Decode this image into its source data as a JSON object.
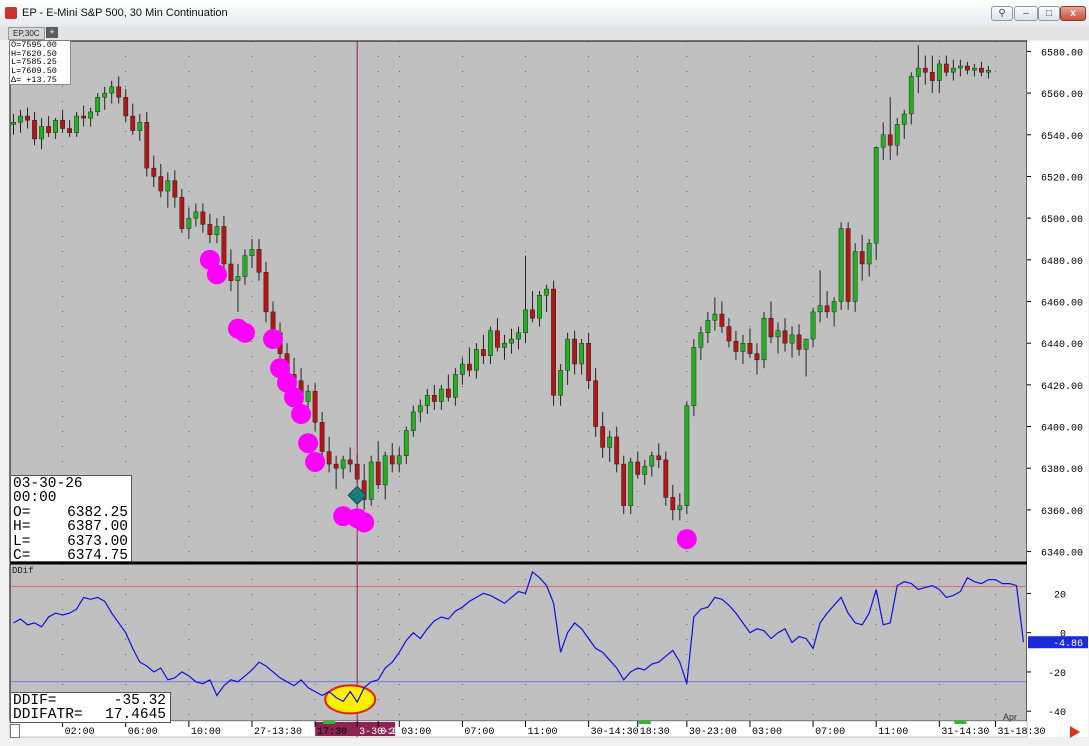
{
  "window": {
    "title": "EP - E-Mini S&P 500, 30 Min Continuation",
    "tab_label": "EP,30C",
    "add_tab": "+",
    "minimize": "–",
    "maximize": "□",
    "close": "x"
  },
  "ohlc_header": {
    "o": "O=7595.00",
    "h": "H=7620.50",
    "l": "L=7585.25",
    "l2": "L=7609.50",
    "d": "Δ= +13.75"
  },
  "data_window": {
    "date": "03-30-26",
    "time": "00:00",
    "o_label": "O=",
    "o": "6382.25",
    "h_label": "H=",
    "h": "6387.00",
    "l_label": "L=",
    "l": "6373.00",
    "c_label": "C=",
    "c": "6374.75"
  },
  "indicator": {
    "name": "DDif",
    "ddif_label": "DDIF=",
    "ddif": "-35.32",
    "ddifatr_label": "DDIFATR=",
    "ddifatr": "17.4645",
    "last_value": "-4.86"
  },
  "end_label": "Apr",
  "colors": {
    "up": "#22b022",
    "down": "#b01818",
    "wick": "#222222",
    "dot": "#ff00ff",
    "diamond": "#1a7a7a",
    "ddif_line": "#1010e0",
    "upper_ref": "#e06060",
    "lower_ref": "#6060e0",
    "cursor": "#8b2252",
    "ellipse_fill": "#ffee00",
    "ellipse_stroke": "#e02020",
    "plot_bg": "#c0c0c0"
  },
  "chart_data": [
    {
      "type": "candlestick",
      "ylim": [
        6335,
        6585
      ],
      "yticks": [
        6340,
        6360,
        6380,
        6400,
        6420,
        6440,
        6460,
        6480,
        6500,
        6520,
        6540,
        6560,
        6580
      ],
      "ytick_labels": [
        "6340.00",
        "6360.00",
        "6380.00",
        "6400.00",
        "6420.00",
        "6440.00",
        "6460.00",
        "6480.00",
        "6500.00",
        "6520.00",
        "6540.00",
        "6560.00",
        "6580.00"
      ],
      "xtick_labels": [
        "02:00",
        "06:00",
        "10:00",
        "27-13:30",
        "17:30",
        "3-30-26",
        "0:00",
        "03:00",
        "07:00",
        "11:00",
        "30-14:30",
        "18:30",
        "30-23:00",
        "03:00",
        "07:00",
        "11:00",
        "31-14:30",
        "31-18:30"
      ],
      "xtick_bars": [
        7,
        16,
        25,
        34,
        43,
        49,
        52,
        55,
        64,
        73,
        82,
        89,
        96,
        105,
        114,
        123,
        132,
        140
      ],
      "bar_count": 145,
      "candles": [
        [
          6545,
          6550,
          6540,
          6546
        ],
        [
          6546,
          6552,
          6541,
          6549
        ],
        [
          6549,
          6553,
          6543,
          6547
        ],
        [
          6547,
          6551,
          6535,
          6538
        ],
        [
          6538,
          6548,
          6533,
          6544
        ],
        [
          6544,
          6549,
          6539,
          6541
        ],
        [
          6541,
          6548,
          6538,
          6547
        ],
        [
          6547,
          6552,
          6541,
          6543
        ],
        [
          6543,
          6547,
          6539,
          6541
        ],
        [
          6541,
          6551,
          6539,
          6549
        ],
        [
          6549,
          6554,
          6544,
          6548
        ],
        [
          6548,
          6553,
          6544,
          6551
        ],
        [
          6551,
          6560,
          6549,
          6558
        ],
        [
          6558,
          6563,
          6552,
          6560
        ],
        [
          6560,
          6566,
          6555,
          6563
        ],
        [
          6563,
          6568,
          6555,
          6558
        ],
        [
          6558,
          6562,
          6546,
          6549
        ],
        [
          6549,
          6555,
          6540,
          6542
        ],
        [
          6542,
          6550,
          6537,
          6546
        ],
        [
          6546,
          6551,
          6520,
          6524
        ],
        [
          6524,
          6530,
          6515,
          6520
        ],
        [
          6520,
          6526,
          6510,
          6513
        ],
        [
          6513,
          6522,
          6505,
          6518
        ],
        [
          6518,
          6523,
          6505,
          6510
        ],
        [
          6510,
          6514,
          6493,
          6495
        ],
        [
          6495,
          6505,
          6490,
          6500
        ],
        [
          6500,
          6507,
          6496,
          6503
        ],
        [
          6503,
          6507,
          6493,
          6497
        ],
        [
          6497,
          6502,
          6488,
          6492
        ],
        [
          6492,
          6500,
          6488,
          6496
        ],
        [
          6496,
          6501,
          6475,
          6478
        ],
        [
          6478,
          6485,
          6465,
          6470
        ],
        [
          6470,
          6478,
          6455,
          6472
        ],
        [
          6472,
          6485,
          6468,
          6482
        ],
        [
          6482,
          6490,
          6476,
          6485
        ],
        [
          6485,
          6490,
          6470,
          6474
        ],
        [
          6474,
          6479,
          6450,
          6455
        ],
        [
          6455,
          6460,
          6440,
          6445
        ],
        [
          6445,
          6450,
          6430,
          6435
        ],
        [
          6435,
          6440,
          6420,
          6425
        ],
        [
          6425,
          6433,
          6418,
          6422
        ],
        [
          6422,
          6428,
          6408,
          6412
        ],
        [
          6412,
          6420,
          6405,
          6417
        ],
        [
          6417,
          6421,
          6398,
          6402
        ],
        [
          6402,
          6407,
          6385,
          6388
        ],
        [
          6388,
          6395,
          6378,
          6382
        ],
        [
          6382,
          6386,
          6370,
          6380
        ],
        [
          6380,
          6386,
          6375,
          6384
        ],
        [
          6384,
          6390,
          6378,
          6382
        ],
        [
          6382,
          6387,
          6373,
          6374.75
        ],
        [
          6374,
          6382,
          6360,
          6365
        ],
        [
          6365,
          6386,
          6362,
          6383
        ],
        [
          6383,
          6393,
          6370,
          6372
        ],
        [
          6372,
          6388,
          6365,
          6386
        ],
        [
          6386,
          6392,
          6378,
          6382
        ],
        [
          6382,
          6390,
          6378,
          6386
        ],
        [
          6386,
          6400,
          6382,
          6398
        ],
        [
          6398,
          6410,
          6395,
          6407
        ],
        [
          6407,
          6413,
          6402,
          6410
        ],
        [
          6410,
          6418,
          6406,
          6415
        ],
        [
          6415,
          6420,
          6408,
          6412
        ],
        [
          6412,
          6420,
          6408,
          6418
        ],
        [
          6418,
          6425,
          6412,
          6414
        ],
        [
          6414,
          6428,
          6410,
          6425
        ],
        [
          6425,
          6433,
          6420,
          6430
        ],
        [
          6430,
          6438,
          6424,
          6427
        ],
        [
          6427,
          6440,
          6423,
          6437
        ],
        [
          6437,
          6444,
          6430,
          6434
        ],
        [
          6434,
          6448,
          6430,
          6446
        ],
        [
          6446,
          6452,
          6436,
          6438
        ],
        [
          6438,
          6444,
          6432,
          6440
        ],
        [
          6440,
          6447,
          6435,
          6442
        ],
        [
          6442,
          6448,
          6437,
          6445
        ],
        [
          6445,
          6482,
          6440,
          6456
        ],
        [
          6456,
          6465,
          6450,
          6452
        ],
        [
          6452,
          6465,
          6448,
          6463
        ],
        [
          6463,
          6468,
          6455,
          6466
        ],
        [
          6466,
          6470,
          6410,
          6415
        ],
        [
          6415,
          6430,
          6410,
          6427
        ],
        [
          6427,
          6445,
          6420,
          6442
        ],
        [
          6442,
          6446,
          6425,
          6430
        ],
        [
          6430,
          6442,
          6425,
          6440
        ],
        [
          6440,
          6445,
          6418,
          6422
        ],
        [
          6422,
          6428,
          6395,
          6400
        ],
        [
          6400,
          6407,
          6385,
          6390
        ],
        [
          6390,
          6398,
          6383,
          6395
        ],
        [
          6395,
          6400,
          6378,
          6382
        ],
        [
          6382,
          6386,
          6358,
          6362
        ],
        [
          6362,
          6385,
          6358,
          6383
        ],
        [
          6383,
          6388,
          6375,
          6377
        ],
        [
          6377,
          6384,
          6372,
          6381
        ],
        [
          6381,
          6388,
          6376,
          6386
        ],
        [
          6386,
          6392,
          6380,
          6384
        ],
        [
          6384,
          6388,
          6362,
          6366
        ],
        [
          6366,
          6372,
          6355,
          6360
        ],
        [
          6360,
          6368,
          6355,
          6362
        ],
        [
          6362,
          6412,
          6358,
          6410
        ],
        [
          6410,
          6442,
          6405,
          6438
        ],
        [
          6438,
          6448,
          6432,
          6445
        ],
        [
          6445,
          6455,
          6440,
          6451
        ],
        [
          6451,
          6462,
          6446,
          6454
        ],
        [
          6454,
          6460,
          6445,
          6448
        ],
        [
          6448,
          6452,
          6438,
          6441
        ],
        [
          6441,
          6446,
          6432,
          6436
        ],
        [
          6436,
          6444,
          6430,
          6440
        ],
        [
          6440,
          6447,
          6433,
          6435
        ],
        [
          6435,
          6440,
          6425,
          6432
        ],
        [
          6432,
          6455,
          6428,
          6452
        ],
        [
          6452,
          6460,
          6440,
          6443
        ],
        [
          6443,
          6450,
          6435,
          6446
        ],
        [
          6446,
          6452,
          6436,
          6440
        ],
        [
          6440,
          6448,
          6433,
          6444
        ],
        [
          6444,
          6449,
          6434,
          6437
        ],
        [
          6437,
          6442,
          6424,
          6442
        ],
        [
          6442,
          6457,
          6438,
          6455
        ],
        [
          6455,
          6475,
          6450,
          6458
        ],
        [
          6458,
          6465,
          6452,
          6455
        ],
        [
          6455,
          6462,
          6448,
          6460
        ],
        [
          6460,
          6498,
          6456,
          6495
        ],
        [
          6495,
          6498,
          6456,
          6460
        ],
        [
          6460,
          6488,
          6455,
          6484
        ],
        [
          6484,
          6492,
          6470,
          6478
        ],
        [
          6478,
          6490,
          6472,
          6488
        ],
        [
          6488,
          6495,
          6480,
          6534
        ],
        [
          6534,
          6546,
          6528,
          6540
        ],
        [
          6540,
          6558,
          6528,
          6535
        ],
        [
          6535,
          6548,
          6530,
          6545
        ],
        [
          6545,
          6552,
          6538,
          6550
        ],
        [
          6550,
          6570,
          6545,
          6568
        ],
        [
          6568,
          6583,
          6560,
          6572
        ],
        [
          6572,
          6578,
          6564,
          6570
        ],
        [
          6570,
          6578,
          6560,
          6566
        ],
        [
          6566,
          6576,
          6560,
          6574
        ],
        [
          6574,
          6578,
          6568,
          6570
        ],
        [
          6570,
          6576,
          6566,
          6572
        ],
        [
          6572,
          6576,
          6568,
          6573
        ],
        [
          6573,
          6575,
          6569,
          6571
        ],
        [
          6571,
          6574,
          6568,
          6572
        ],
        [
          6572,
          6575,
          6568,
          6570
        ],
        [
          6570,
          6573,
          6567,
          6571
        ]
      ],
      "dots": [
        [
          28,
          6480
        ],
        [
          29,
          6473
        ],
        [
          32,
          6447
        ],
        [
          33,
          6445
        ],
        [
          37,
          6442
        ],
        [
          38,
          6428
        ],
        [
          39,
          6421
        ],
        [
          40,
          6414
        ],
        [
          41,
          6406
        ],
        [
          42,
          6392
        ],
        [
          43,
          6383
        ],
        [
          47,
          6357
        ],
        [
          49,
          6356
        ],
        [
          50,
          6354
        ],
        [
          96,
          6346
        ]
      ],
      "diamond": [
        49,
        6367
      ],
      "cursor_bar": 49
    },
    {
      "type": "line",
      "name": "DDif",
      "ylim": [
        -45,
        35
      ],
      "yticks": [
        -40,
        -20,
        0,
        20
      ],
      "ytick_labels": [
        "-40",
        "-20",
        "0",
        "20"
      ],
      "ref_upper": 23.5,
      "ref_lower": -25,
      "values": [
        5,
        7,
        4,
        5,
        3,
        8,
        10,
        9,
        10,
        12,
        18,
        17,
        18,
        16,
        10,
        5,
        0,
        -8,
        -15,
        -17,
        -20,
        -18,
        -24,
        -23,
        -20,
        -22,
        -25,
        -26,
        -24,
        -32,
        -27,
        -24,
        -25,
        -22,
        -19,
        -15,
        -17,
        -20,
        -23,
        -25,
        -27,
        -24,
        -28,
        -30,
        -32,
        -30,
        -33,
        -35,
        -30,
        -35.32,
        -28,
        -25,
        -24,
        -18,
        -15,
        -10,
        -4,
        0,
        -3,
        2,
        6,
        8,
        7,
        11,
        13,
        16,
        18,
        20,
        19,
        17,
        15,
        18,
        21,
        20,
        31,
        28,
        24,
        15,
        -10,
        0,
        5,
        2,
        -3,
        -8,
        -10,
        -14,
        -18,
        -24,
        -20,
        -18,
        -19,
        -16,
        -15,
        -12,
        -9,
        -15,
        -26,
        8,
        12,
        13,
        18,
        17,
        14,
        10,
        5,
        0,
        2,
        1,
        -3,
        0,
        2,
        -5,
        -2,
        -3,
        -8,
        5,
        10,
        14,
        18,
        10,
        5,
        4,
        10,
        22,
        4,
        5,
        24,
        26,
        25,
        22,
        23,
        24,
        22,
        18,
        19,
        21,
        28,
        26,
        25,
        27,
        27,
        25,
        25,
        24,
        -4.86
      ]
    }
  ]
}
